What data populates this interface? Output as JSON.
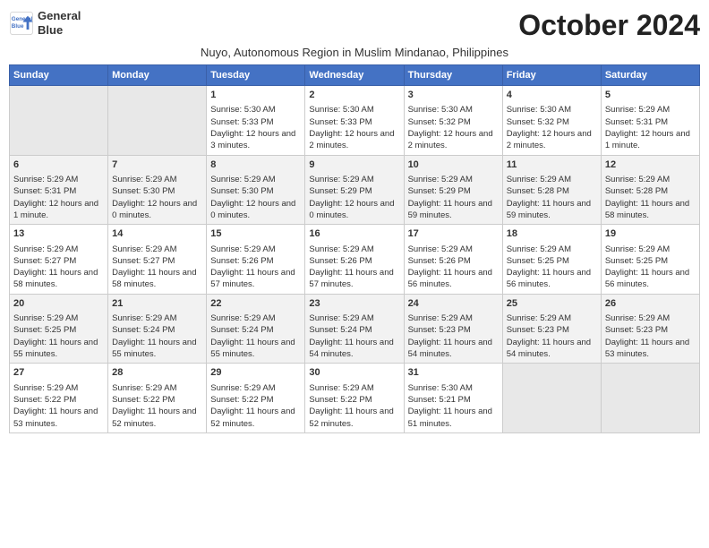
{
  "logo": {
    "line1": "General",
    "line2": "Blue"
  },
  "title": "October 2024",
  "subtitle": "Nuyo, Autonomous Region in Muslim Mindanao, Philippines",
  "days_of_week": [
    "Sunday",
    "Monday",
    "Tuesday",
    "Wednesday",
    "Thursday",
    "Friday",
    "Saturday"
  ],
  "weeks": [
    [
      {
        "day": "",
        "info": ""
      },
      {
        "day": "",
        "info": ""
      },
      {
        "day": "1",
        "info": "Sunrise: 5:30 AM\nSunset: 5:33 PM\nDaylight: 12 hours and 3 minutes."
      },
      {
        "day": "2",
        "info": "Sunrise: 5:30 AM\nSunset: 5:33 PM\nDaylight: 12 hours and 2 minutes."
      },
      {
        "day": "3",
        "info": "Sunrise: 5:30 AM\nSunset: 5:32 PM\nDaylight: 12 hours and 2 minutes."
      },
      {
        "day": "4",
        "info": "Sunrise: 5:30 AM\nSunset: 5:32 PM\nDaylight: 12 hours and 2 minutes."
      },
      {
        "day": "5",
        "info": "Sunrise: 5:29 AM\nSunset: 5:31 PM\nDaylight: 12 hours and 1 minute."
      }
    ],
    [
      {
        "day": "6",
        "info": "Sunrise: 5:29 AM\nSunset: 5:31 PM\nDaylight: 12 hours and 1 minute."
      },
      {
        "day": "7",
        "info": "Sunrise: 5:29 AM\nSunset: 5:30 PM\nDaylight: 12 hours and 0 minutes."
      },
      {
        "day": "8",
        "info": "Sunrise: 5:29 AM\nSunset: 5:30 PM\nDaylight: 12 hours and 0 minutes."
      },
      {
        "day": "9",
        "info": "Sunrise: 5:29 AM\nSunset: 5:29 PM\nDaylight: 12 hours and 0 minutes."
      },
      {
        "day": "10",
        "info": "Sunrise: 5:29 AM\nSunset: 5:29 PM\nDaylight: 11 hours and 59 minutes."
      },
      {
        "day": "11",
        "info": "Sunrise: 5:29 AM\nSunset: 5:28 PM\nDaylight: 11 hours and 59 minutes."
      },
      {
        "day": "12",
        "info": "Sunrise: 5:29 AM\nSunset: 5:28 PM\nDaylight: 11 hours and 58 minutes."
      }
    ],
    [
      {
        "day": "13",
        "info": "Sunrise: 5:29 AM\nSunset: 5:27 PM\nDaylight: 11 hours and 58 minutes."
      },
      {
        "day": "14",
        "info": "Sunrise: 5:29 AM\nSunset: 5:27 PM\nDaylight: 11 hours and 58 minutes."
      },
      {
        "day": "15",
        "info": "Sunrise: 5:29 AM\nSunset: 5:26 PM\nDaylight: 11 hours and 57 minutes."
      },
      {
        "day": "16",
        "info": "Sunrise: 5:29 AM\nSunset: 5:26 PM\nDaylight: 11 hours and 57 minutes."
      },
      {
        "day": "17",
        "info": "Sunrise: 5:29 AM\nSunset: 5:26 PM\nDaylight: 11 hours and 56 minutes."
      },
      {
        "day": "18",
        "info": "Sunrise: 5:29 AM\nSunset: 5:25 PM\nDaylight: 11 hours and 56 minutes."
      },
      {
        "day": "19",
        "info": "Sunrise: 5:29 AM\nSunset: 5:25 PM\nDaylight: 11 hours and 56 minutes."
      }
    ],
    [
      {
        "day": "20",
        "info": "Sunrise: 5:29 AM\nSunset: 5:25 PM\nDaylight: 11 hours and 55 minutes."
      },
      {
        "day": "21",
        "info": "Sunrise: 5:29 AM\nSunset: 5:24 PM\nDaylight: 11 hours and 55 minutes."
      },
      {
        "day": "22",
        "info": "Sunrise: 5:29 AM\nSunset: 5:24 PM\nDaylight: 11 hours and 55 minutes."
      },
      {
        "day": "23",
        "info": "Sunrise: 5:29 AM\nSunset: 5:24 PM\nDaylight: 11 hours and 54 minutes."
      },
      {
        "day": "24",
        "info": "Sunrise: 5:29 AM\nSunset: 5:23 PM\nDaylight: 11 hours and 54 minutes."
      },
      {
        "day": "25",
        "info": "Sunrise: 5:29 AM\nSunset: 5:23 PM\nDaylight: 11 hours and 54 minutes."
      },
      {
        "day": "26",
        "info": "Sunrise: 5:29 AM\nSunset: 5:23 PM\nDaylight: 11 hours and 53 minutes."
      }
    ],
    [
      {
        "day": "27",
        "info": "Sunrise: 5:29 AM\nSunset: 5:22 PM\nDaylight: 11 hours and 53 minutes."
      },
      {
        "day": "28",
        "info": "Sunrise: 5:29 AM\nSunset: 5:22 PM\nDaylight: 11 hours and 52 minutes."
      },
      {
        "day": "29",
        "info": "Sunrise: 5:29 AM\nSunset: 5:22 PM\nDaylight: 11 hours and 52 minutes."
      },
      {
        "day": "30",
        "info": "Sunrise: 5:29 AM\nSunset: 5:22 PM\nDaylight: 11 hours and 52 minutes."
      },
      {
        "day": "31",
        "info": "Sunrise: 5:30 AM\nSunset: 5:21 PM\nDaylight: 11 hours and 51 minutes."
      },
      {
        "day": "",
        "info": ""
      },
      {
        "day": "",
        "info": ""
      }
    ]
  ]
}
